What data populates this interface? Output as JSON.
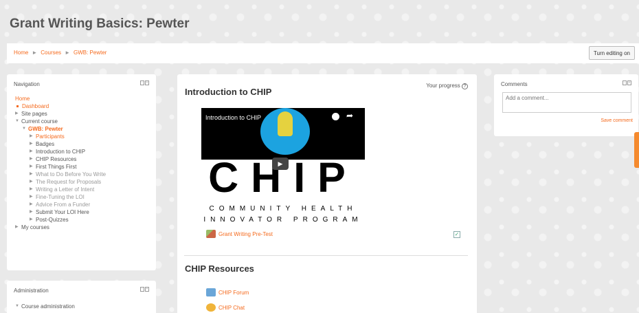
{
  "page": {
    "title": "Grant Writing Basics: Pewter"
  },
  "breadcrumb": {
    "items": [
      "Home",
      "Courses",
      "GWB: Pewter"
    ],
    "separator": "►"
  },
  "header": {
    "edit_button": "Turn editing on"
  },
  "navigation": {
    "title": "Navigation",
    "items": [
      {
        "label": "Home",
        "style": "orange",
        "indent": 0,
        "marker": "none"
      },
      {
        "label": "Dashboard",
        "style": "orange",
        "indent": 1,
        "marker": "bullet"
      },
      {
        "label": "Site pages",
        "style": "normal",
        "indent": 1,
        "marker": "collapsed"
      },
      {
        "label": "Current course",
        "style": "normal",
        "indent": 1,
        "marker": "expanded"
      },
      {
        "label": "GWB: Pewter",
        "style": "orange-bold",
        "indent": 2,
        "marker": "expanded"
      },
      {
        "label": "Participants",
        "style": "orange",
        "indent": 3,
        "marker": "collapsed"
      },
      {
        "label": "Badges",
        "style": "normal",
        "indent": 3,
        "marker": "collapsed"
      },
      {
        "label": "Introduction to CHIP",
        "style": "normal",
        "indent": 3,
        "marker": "collapsed"
      },
      {
        "label": "CHIP Resources",
        "style": "normal",
        "indent": 3,
        "marker": "collapsed"
      },
      {
        "label": "First Things First",
        "style": "normal",
        "indent": 3,
        "marker": "collapsed"
      },
      {
        "label": "What to Do Before You Write",
        "style": "faded",
        "indent": 3,
        "marker": "collapsed"
      },
      {
        "label": "The Request for Proposals",
        "style": "faded",
        "indent": 3,
        "marker": "collapsed"
      },
      {
        "label": "Writing a Letter of Intent",
        "style": "faded",
        "indent": 3,
        "marker": "collapsed"
      },
      {
        "label": "Fine-Tuning the LOI",
        "style": "faded",
        "indent": 3,
        "marker": "collapsed"
      },
      {
        "label": "Advice From a Funder",
        "style": "faded",
        "indent": 3,
        "marker": "collapsed"
      },
      {
        "label": "Submit Your LOI Here",
        "style": "normal",
        "indent": 3,
        "marker": "collapsed"
      },
      {
        "label": "Post-Quizzes",
        "style": "normal",
        "indent": 3,
        "marker": "collapsed"
      },
      {
        "label": "My courses",
        "style": "normal",
        "indent": 1,
        "marker": "collapsed"
      }
    ]
  },
  "administration": {
    "title": "Administration",
    "items": [
      {
        "label": "Course administration",
        "marker": "expanded"
      }
    ]
  },
  "main": {
    "section1_title": "Introduction to CHIP",
    "progress_label": "Your progress",
    "video": {
      "title": "Introduction to CHIP",
      "big_text": "CHIP",
      "subtitle1": "COMMUNITY HEALTH",
      "subtitle2": "INNOVATOR PROGRAM"
    },
    "quiz_link": "Grant Writing Pre-Test",
    "section2_title": "CHIP Resources",
    "resources": [
      "CHIP Forum",
      "CHIP Chat"
    ]
  },
  "comments": {
    "title": "Comments",
    "placeholder": "Add a comment...",
    "save_label": "Save comment"
  },
  "colors": {
    "accent": "#f56a1d",
    "video_circle": "#1ca3e0",
    "bulb": "#e5d23f"
  }
}
